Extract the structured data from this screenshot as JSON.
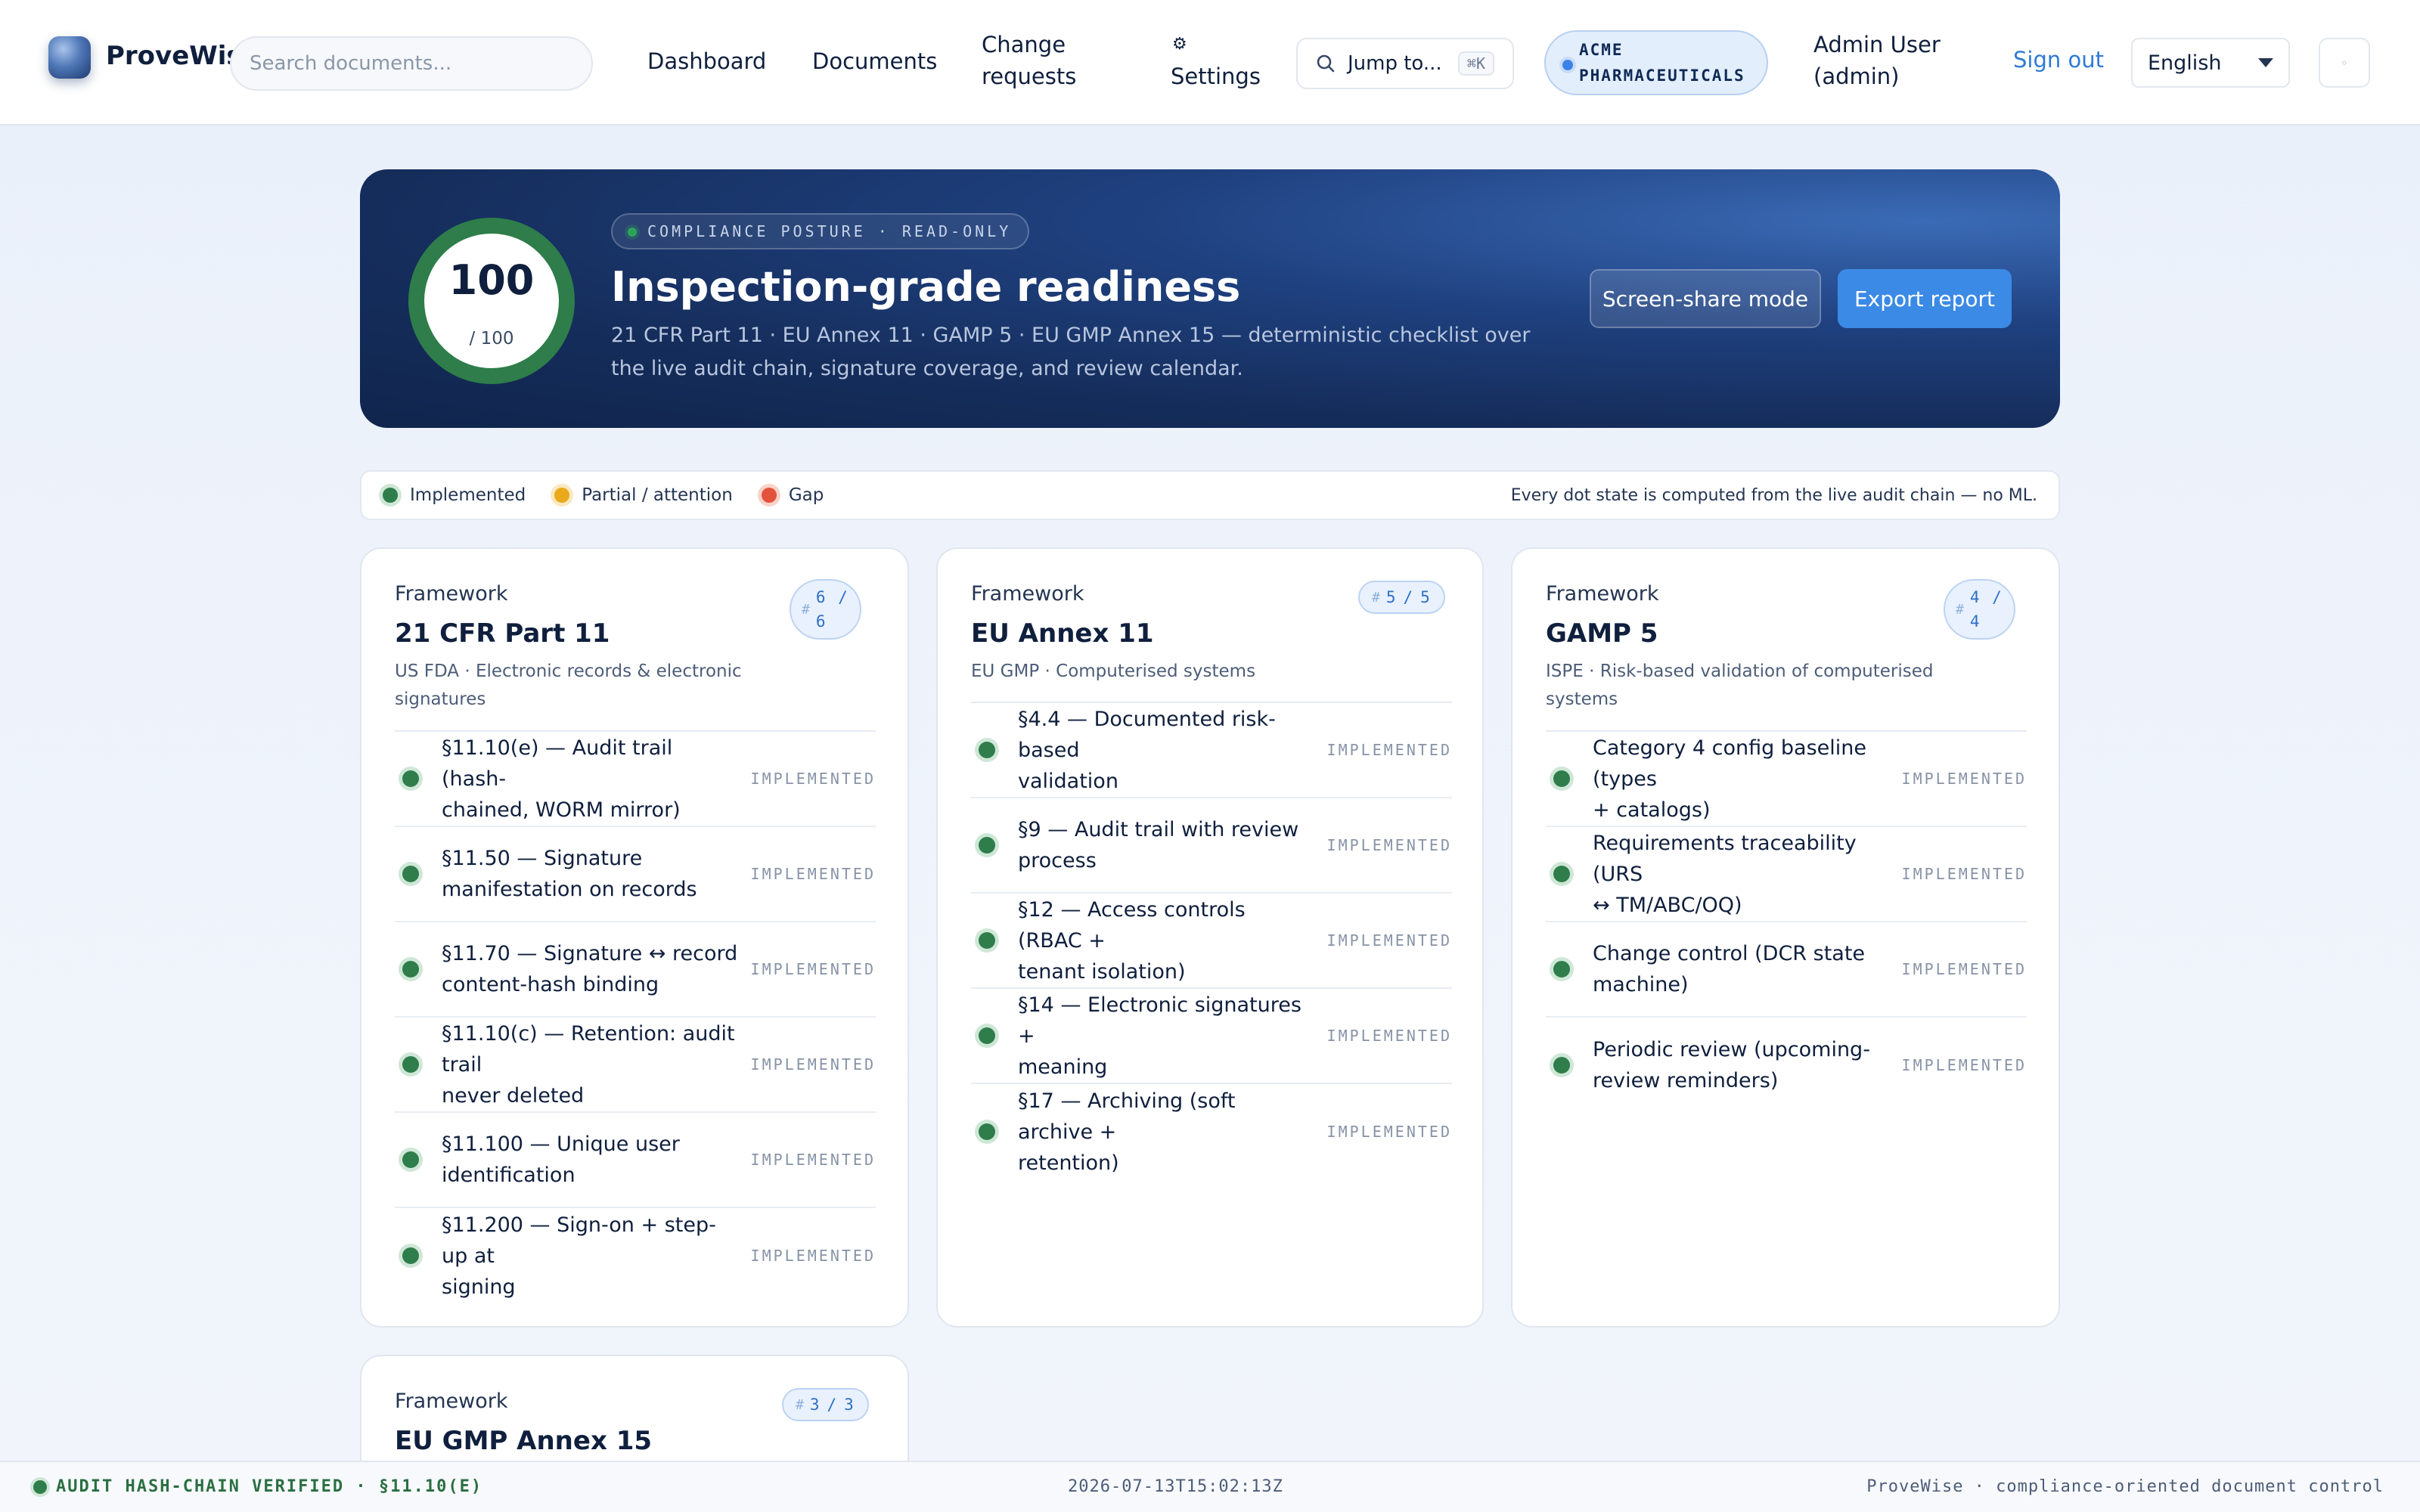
{
  "app": {
    "name": "ProveWise",
    "search_placeholder": "Search documents..."
  },
  "nav": {
    "dashboard": "Dashboard",
    "documents": "Documents",
    "change_requests_line1": "Change",
    "change_requests_line2": "requests",
    "settings_icon": "⚙",
    "settings": "Settings",
    "jump_label": "Jump to...",
    "jump_shortcut": "⌘K",
    "tenant_line1": "ACME",
    "tenant_line2": "PHARMACEUTICALS",
    "user_line1": "Admin User",
    "user_line2": "(admin)",
    "sign_out": "Sign out",
    "language": "English",
    "theme_glyph": "◦"
  },
  "hero": {
    "score": "100",
    "score_max": "/ 100",
    "badge": "COMPLIANCE POSTURE · READ-ONLY",
    "title": "Inspection-grade readiness",
    "subtitle": "21 CFR Part 11 · EU Annex 11 · GAMP 5 · EU GMP Annex 15 — deterministic checklist over the live audit chain, signature coverage, and review calendar.",
    "screen_share_label": "Screen-share mode",
    "export_label": "Export report"
  },
  "legend": {
    "implemented": "Implemented",
    "partial": "Partial / attention",
    "gap": "Gap",
    "note": "Every dot state is computed from the live audit chain — no ML."
  },
  "frameworks": [
    {
      "label": "Framework",
      "title": "21 CFR Part 11",
      "description_line1": "US FDA · Electronic records & electronic",
      "description_line2": "signatures",
      "count_a": "6",
      "count_b": "6",
      "requirements": [
        {
          "line1": "§11.10(e) — Audit trail (hash-",
          "line2": "chained, WORM mirror)",
          "status": "IMPLEMENTED"
        },
        {
          "line1": "§11.50 — Signature",
          "line2": "manifestation on records",
          "status": "IMPLEMENTED"
        },
        {
          "line1": "§11.70 — Signature ↔ record",
          "line2": "content-hash binding",
          "status": "IMPLEMENTED"
        },
        {
          "line1": "§11.10(c) — Retention: audit trail",
          "line2": "never deleted",
          "status": "IMPLEMENTED"
        },
        {
          "line1": "§11.100 — Unique user",
          "line2": "identification",
          "status": "IMPLEMENTED"
        },
        {
          "line1": "§11.200 — Sign-on + step-up at",
          "line2": "signing",
          "status": "IMPLEMENTED"
        }
      ]
    },
    {
      "label": "Framework",
      "title": "EU Annex 11",
      "description_line1": "EU GMP · Computerised systems",
      "count_a": "5",
      "count_b": "5",
      "requirements": [
        {
          "line1": "§4.4 — Documented risk-based",
          "line2": "validation",
          "status": "IMPLEMENTED"
        },
        {
          "line1": "§9 — Audit trail with review",
          "line2": "process",
          "status": "IMPLEMENTED"
        },
        {
          "line1": "§12 — Access controls (RBAC +",
          "line2": "tenant isolation)",
          "status": "IMPLEMENTED"
        },
        {
          "line1": "§14 — Electronic signatures +",
          "line2": "meaning",
          "status": "IMPLEMENTED"
        },
        {
          "line1": "§17 — Archiving (soft archive +",
          "line2": "retention)",
          "status": "IMPLEMENTED"
        }
      ]
    },
    {
      "label": "Framework",
      "title": "GAMP 5",
      "description_line1": "ISPE · Risk-based validation of computerised",
      "description_line2": "systems",
      "count_a": "4",
      "count_b": "4",
      "requirements": [
        {
          "line1": "Category 4 config baseline (types",
          "line2": "+ catalogs)",
          "status": "IMPLEMENTED"
        },
        {
          "line1": "Requirements traceability (URS",
          "line2": "↔ TM/ABC/OQ)",
          "status": "IMPLEMENTED"
        },
        {
          "line1": "Change control (DCR state",
          "line2": "machine)",
          "status": "IMPLEMENTED"
        },
        {
          "line1": "Periodic review (upcoming-",
          "line2": "review reminders)",
          "status": "IMPLEMENTED"
        }
      ]
    },
    {
      "label": "Framework",
      "title": "EU GMP Annex 15",
      "count_a": "3",
      "count_b": "3"
    }
  ],
  "footer": {
    "left": "AUDIT HASH-CHAIN VERIFIED · §11.10(E)",
    "timestamp": "2026-07-13T15:02:13Z",
    "right": "ProveWise · compliance-oriented document control"
  },
  "colors": {
    "implemented": "#2e7d4a",
    "partial": "#e9a91a",
    "gap": "#e3533b",
    "accent": "#3b8ae6",
    "hero_bg": "#152d5b"
  }
}
